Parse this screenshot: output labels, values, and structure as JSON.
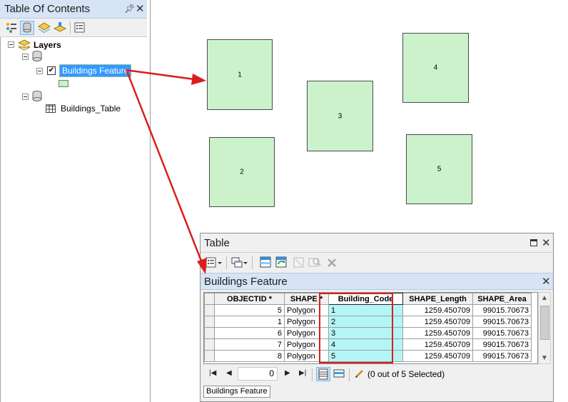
{
  "colors": {
    "arrow": "#d81f1f",
    "selection": "#3399ff",
    "building_fill": "#ccf2cc",
    "code_cell_fill": "#b4f6f6",
    "panel_title_bg": "#d6e4f5"
  },
  "toc": {
    "title": "Table Of Contents",
    "pin_icon": "pin-icon",
    "close_icon": "close-icon",
    "toolbar_icons": [
      "list-by-drawing-order-icon",
      "list-by-source-icon",
      "list-by-visibility-icon",
      "list-by-selection-icon",
      "options-icon"
    ],
    "tree": {
      "root_label": "Layers",
      "feature_layer_label": "Buildings Feature",
      "feature_layer_checked": true,
      "table_label": "Buildings_Table"
    }
  },
  "map": {
    "buildings": [
      {
        "label": "1"
      },
      {
        "label": "2"
      },
      {
        "label": "3"
      },
      {
        "label": "4"
      },
      {
        "label": "5"
      }
    ]
  },
  "table_window": {
    "title": "Table",
    "maximize_icon": "maximize-icon",
    "close_icon": "close-icon",
    "toolbar_icons": [
      "table-options-icon",
      "related-tables-icon",
      "select-by-attributes-icon",
      "switch-selection-icon",
      "clear-selection-icon",
      "zoom-to-selected-icon",
      "delete-selected-icon"
    ],
    "subtitle": "Buildings Feature",
    "columns": [
      "OBJECTID *",
      "SHAPE *",
      "Building_Code",
      "SHAPE_Length",
      "SHAPE_Area"
    ],
    "rows": [
      [
        "5",
        "Polygon",
        "1",
        "1259.450709",
        "99015.70673"
      ],
      [
        "1",
        "Polygon",
        "2",
        "1259.450709",
        "99015.70673"
      ],
      [
        "6",
        "Polygon",
        "3",
        "1259.450709",
        "99015.70673"
      ],
      [
        "7",
        "Polygon",
        "4",
        "1259.450709",
        "99015.70673"
      ],
      [
        "8",
        "Polygon",
        "5",
        "1259.450709",
        "99015.70673"
      ]
    ],
    "current_record": "0",
    "selection_status": "(0 out of 5 Selected)",
    "layer_tab": "Buildings Feature"
  }
}
